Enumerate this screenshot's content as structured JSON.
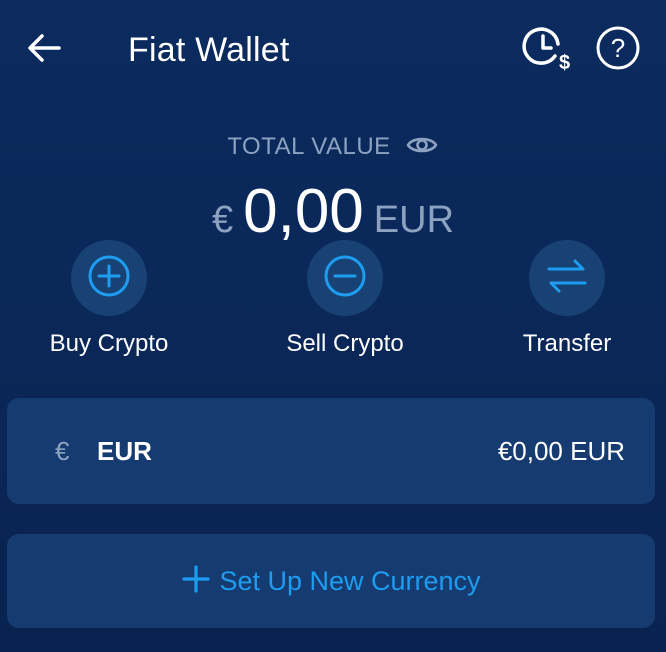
{
  "header": {
    "title": "Fiat Wallet",
    "back_icon": "arrow-left-icon",
    "history_icon": "clock-dollar-icon",
    "help_icon": "question-circle-icon"
  },
  "total": {
    "label": "TOTAL VALUE",
    "eye_icon": "eye-icon",
    "symbol": "€",
    "amount": "0,00",
    "currency": "EUR"
  },
  "actions": [
    {
      "label": "Buy Crypto",
      "icon": "plus-circle-icon"
    },
    {
      "label": "Sell Crypto",
      "icon": "minus-circle-icon"
    },
    {
      "label": "Transfer",
      "icon": "swap-arrows-icon"
    }
  ],
  "currencies": [
    {
      "symbol": "€",
      "code": "EUR",
      "balance": "€0,00 EUR"
    }
  ],
  "add_currency": {
    "label": "Set Up New Currency",
    "icon": "plus-icon"
  },
  "colors": {
    "background": "#0b2a5e",
    "card": "#153b70",
    "action_circle": "#184274",
    "accent": "#1e9cf0",
    "muted_text": "#8da2c1",
    "text": "#ffffff"
  }
}
